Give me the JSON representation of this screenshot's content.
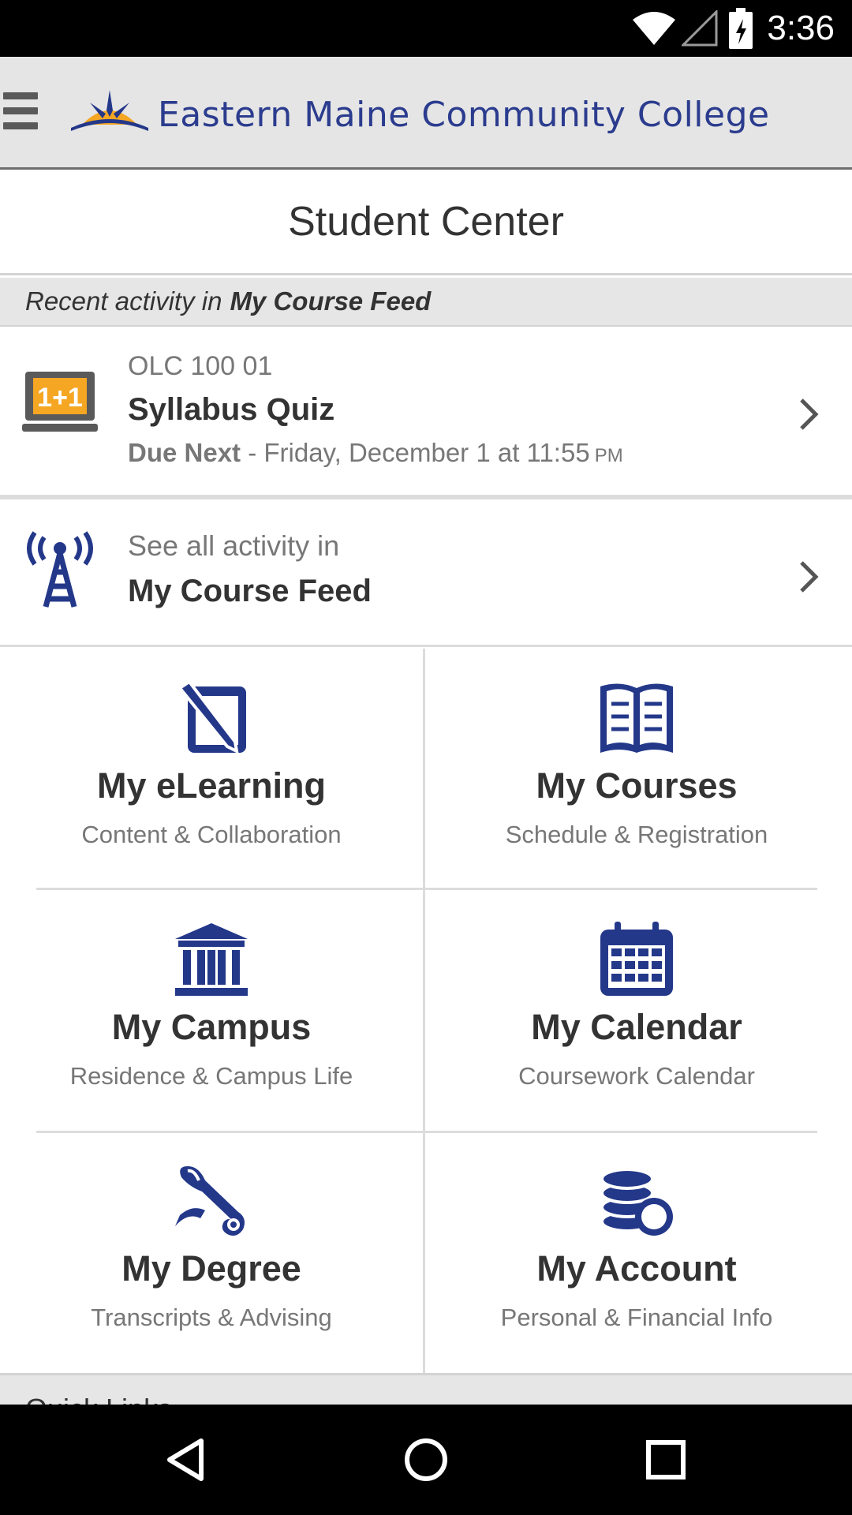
{
  "status_bar": {
    "time": "3:36"
  },
  "header": {
    "college_name": "Eastern Maine Community College"
  },
  "page": {
    "title": "Student Center"
  },
  "recent": {
    "prefix": "Recent activity in",
    "feed_name": "My Course Feed"
  },
  "quiz": {
    "course": "OLC 100 01",
    "title": "Syllabus Quiz",
    "due_label": "Due Next",
    "due_text": " - Friday, December 1 at 11:55",
    "due_ampm": "PM"
  },
  "feed_link": {
    "see_all": "See all activity in",
    "name": "My Course Feed"
  },
  "tiles": [
    {
      "title": "My eLearning",
      "subtitle": "Content & Collaboration",
      "icon": "edit-icon"
    },
    {
      "title": "My Courses",
      "subtitle": "Schedule & Registration",
      "icon": "book-icon"
    },
    {
      "title": "My Campus",
      "subtitle": "Residence & Campus Life",
      "icon": "building-icon"
    },
    {
      "title": "My Calendar",
      "subtitle": "Coursework Calendar",
      "icon": "calendar-icon"
    },
    {
      "title": "My Degree",
      "subtitle": "Transcripts & Advising",
      "icon": "diploma-icon"
    },
    {
      "title": "My Account",
      "subtitle": "Personal & Financial Info",
      "icon": "coins-icon"
    }
  ],
  "quick_links": {
    "label": "Quick Links"
  },
  "colors": {
    "brand_blue": "#24388a",
    "accent_gold": "#f5a623",
    "text_dark": "#333333",
    "text_muted": "#777777"
  }
}
